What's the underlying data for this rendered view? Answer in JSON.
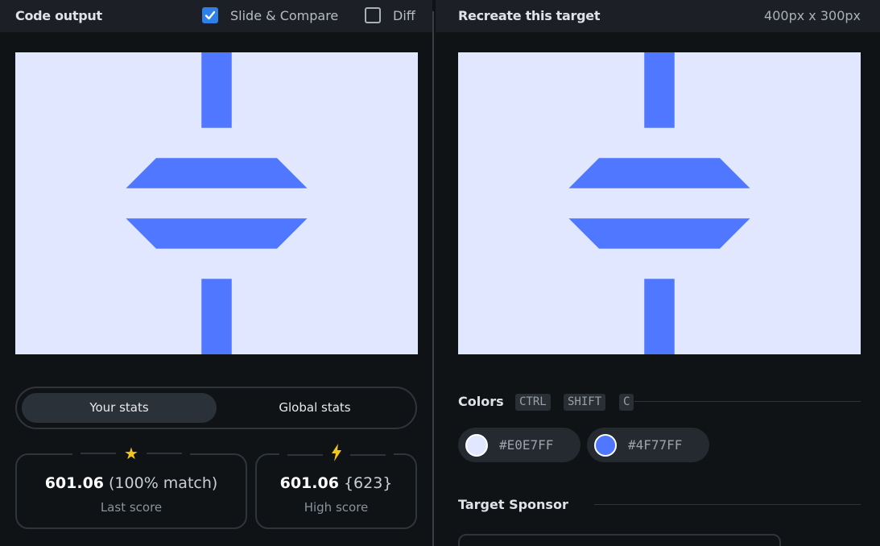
{
  "left_header": {
    "title": "Code output",
    "slide_compare_label": "Slide & Compare",
    "slide_compare_checked": true,
    "diff_label": "Diff",
    "diff_checked": false
  },
  "right_header": {
    "title": "Recreate this target",
    "dimensions": "400px x 300px"
  },
  "stats": {
    "tabs": [
      "Your stats",
      "Global stats"
    ],
    "active_tab": "Your stats",
    "last": {
      "score": "601.06",
      "detail": "(100% match)",
      "caption": "Last score",
      "icon": "star-icon"
    },
    "high": {
      "score": "601.06",
      "detail": "{623}",
      "caption": "High score",
      "icon": "lightning-icon"
    }
  },
  "colors_section": {
    "title": "Colors",
    "shortcut": [
      "CTRL",
      "SHIFT",
      "C"
    ],
    "swatches": [
      {
        "hex": "#E0E7FF",
        "color": "#E0E7FF"
      },
      {
        "hex": "#4F77FF",
        "color": "#4F77FF"
      }
    ]
  },
  "sponsor_section": {
    "title": "Target Sponsor"
  },
  "palette": {
    "background": "#E0E7FF",
    "shape": "#4F77FF",
    "accent": "#2F7FE8",
    "icon": "#F5C518"
  }
}
